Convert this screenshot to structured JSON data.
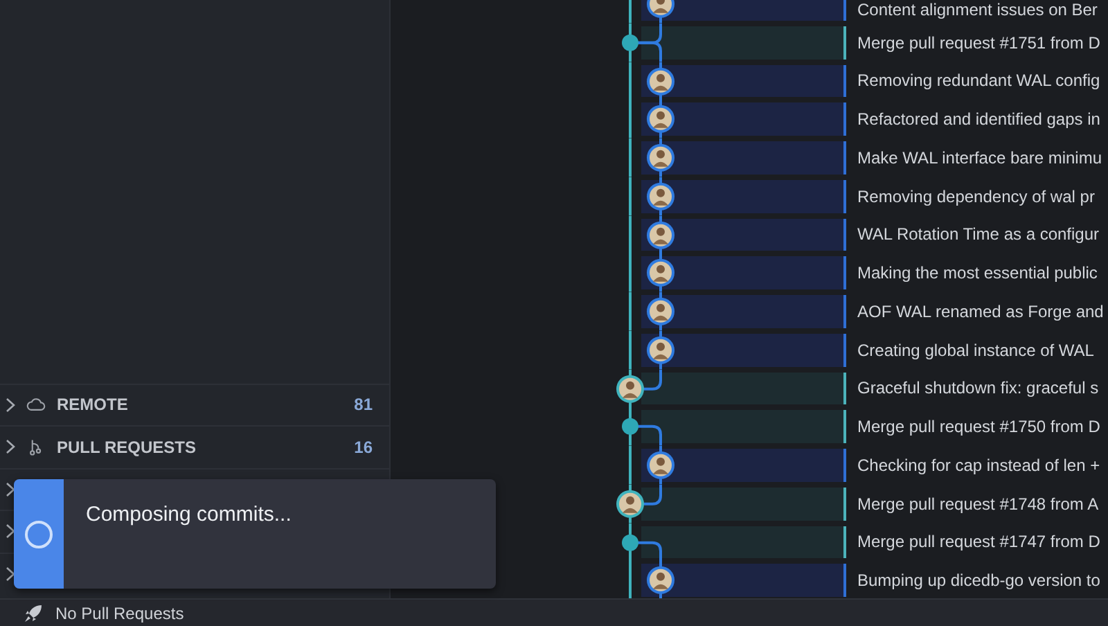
{
  "sidebar": {
    "sections": [
      {
        "kind": "remote",
        "label": "REMOTE",
        "count": "81",
        "expanded": false
      },
      {
        "kind": "pull_requests",
        "label": "PULL REQUESTS",
        "count": "16",
        "expanded": false
      },
      {
        "kind": "covered",
        "expanded": false
      },
      {
        "kind": "covered",
        "expanded": false
      },
      {
        "kind": "covered",
        "expanded": false
      }
    ]
  },
  "toast": {
    "message": "Composing commits..."
  },
  "commits": [
    {
      "kind": "commit",
      "message": "Content alignment issues on Ber"
    },
    {
      "kind": "merge",
      "message": "Merge pull request #1751 from D"
    },
    {
      "kind": "commit",
      "message": "Removing redundant WAL config"
    },
    {
      "kind": "commit",
      "message": "Refactored and identified gaps in"
    },
    {
      "kind": "commit",
      "message": "Make WAL interface bare minimu"
    },
    {
      "kind": "commit",
      "message": "Removing dependency of wal pr"
    },
    {
      "kind": "commit",
      "message": "WAL Rotation Time as a configur"
    },
    {
      "kind": "commit",
      "message": "Making the most essential public"
    },
    {
      "kind": "commit",
      "message": "AOF WAL renamed as Forge and"
    },
    {
      "kind": "commit",
      "message": "Creating global instance of WAL"
    },
    {
      "kind": "mainline",
      "message": "Graceful shutdown fix: graceful s"
    },
    {
      "kind": "merge",
      "message": "Merge pull request #1750 from D"
    },
    {
      "kind": "commit",
      "message": "Checking for cap instead of len +"
    },
    {
      "kind": "mainline",
      "message": "Merge pull request #1748 from A"
    },
    {
      "kind": "merge",
      "message": "Merge pull request #1747 from D"
    },
    {
      "kind": "commit",
      "message": "Bumping up dicedb-go version to"
    }
  ],
  "status_bar": {
    "text": "No Pull Requests"
  }
}
